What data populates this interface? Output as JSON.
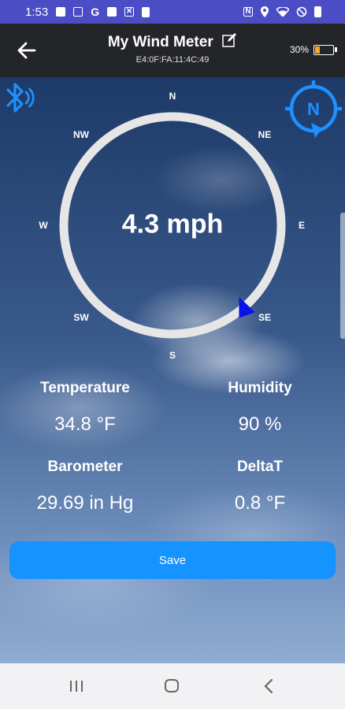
{
  "status_bar": {
    "time": "1:53",
    "left_icons": [
      "shopping-bag-icon",
      "document-icon",
      "g-icon",
      "image-icon",
      "x-icon",
      "clipboard-icon"
    ],
    "right_icons": [
      "nfc-icon",
      "location-icon",
      "wifi-icon",
      "do-not-disturb-icon",
      "battery-icon"
    ]
  },
  "toolbar": {
    "title": "My Wind Meter",
    "device_id": "E4:0F:FA:11:4C:49",
    "battery_percent": "30%",
    "battery_level": 0.3,
    "battery_color": "#f5a623"
  },
  "compass": {
    "speed": "4.3 mph",
    "directions": {
      "n": "N",
      "ne": "NE",
      "e": "E",
      "se": "SE",
      "s": "S",
      "sw": "SW",
      "w": "W",
      "nw": "NW"
    },
    "wind_direction_deg": 138,
    "ring_color": "#e6e6e6",
    "needle_color": "#0a14e8",
    "accent_color": "#1e90ff"
  },
  "metrics": {
    "temperature": {
      "label": "Temperature",
      "value": "34.8 °F"
    },
    "humidity": {
      "label": "Humidity",
      "value": "90 %"
    },
    "barometer": {
      "label": "Barometer",
      "value": "29.69 in Hg"
    },
    "deltat": {
      "label": "DeltaT",
      "value": "0.8 °F"
    }
  },
  "save_button": {
    "label": "Save",
    "color": "#1593ff"
  },
  "nav_bar": {
    "icons": [
      "recents-icon",
      "home-icon",
      "back-icon"
    ]
  }
}
